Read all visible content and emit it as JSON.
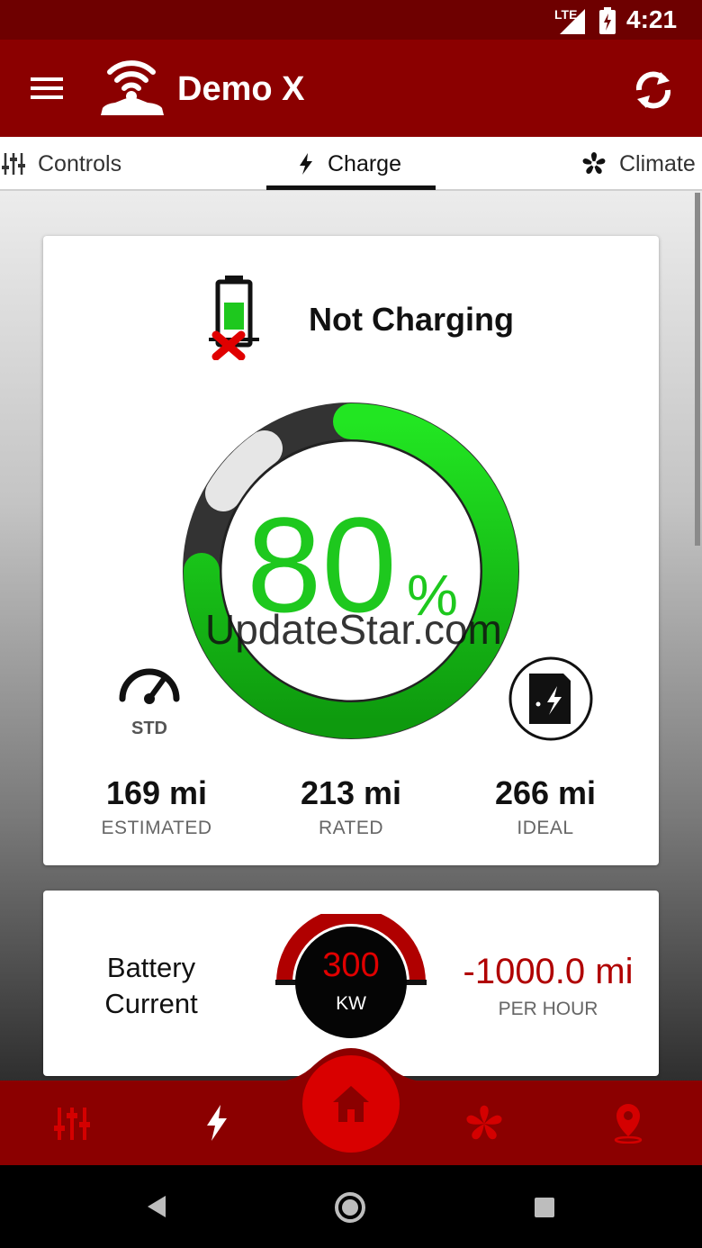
{
  "status_bar": {
    "network": "LTE",
    "time": "4:21"
  },
  "app_bar": {
    "title": "Demo X",
    "icons": [
      "menu-icon",
      "car-wifi-logo",
      "refresh-icon"
    ]
  },
  "tabs": [
    {
      "label": "Controls",
      "icon": "sliders-icon"
    },
    {
      "label": "Charge",
      "icon": "bolt-icon",
      "selected": true
    },
    {
      "label": "Climate",
      "icon": "fan-icon"
    }
  ],
  "charge": {
    "status": "Not Charging",
    "percent": "80",
    "percent_sign": "%",
    "level_fraction": 0.8,
    "range_mode": "STD"
  },
  "ranges": [
    {
      "value": "169 mi",
      "label": "ESTIMATED"
    },
    {
      "value": "213 mi",
      "label": "RATED"
    },
    {
      "value": "266 mi",
      "label": "IDEAL"
    }
  ],
  "battery_current": {
    "label_line1": "Battery",
    "label_line2": "Current",
    "power_value": "300",
    "power_unit": "KW",
    "rate_value": "-1000.0 mi",
    "rate_label": "PER HOUR"
  },
  "watermark": "UpdateStar.com",
  "colors": {
    "primary": "#8b0000",
    "accent": "#d90000",
    "gauge_green": "#1ec81e"
  },
  "bottom_nav": [
    "sliders-icon",
    "bolt-icon",
    "home-icon",
    "fan-icon",
    "location-icon"
  ]
}
